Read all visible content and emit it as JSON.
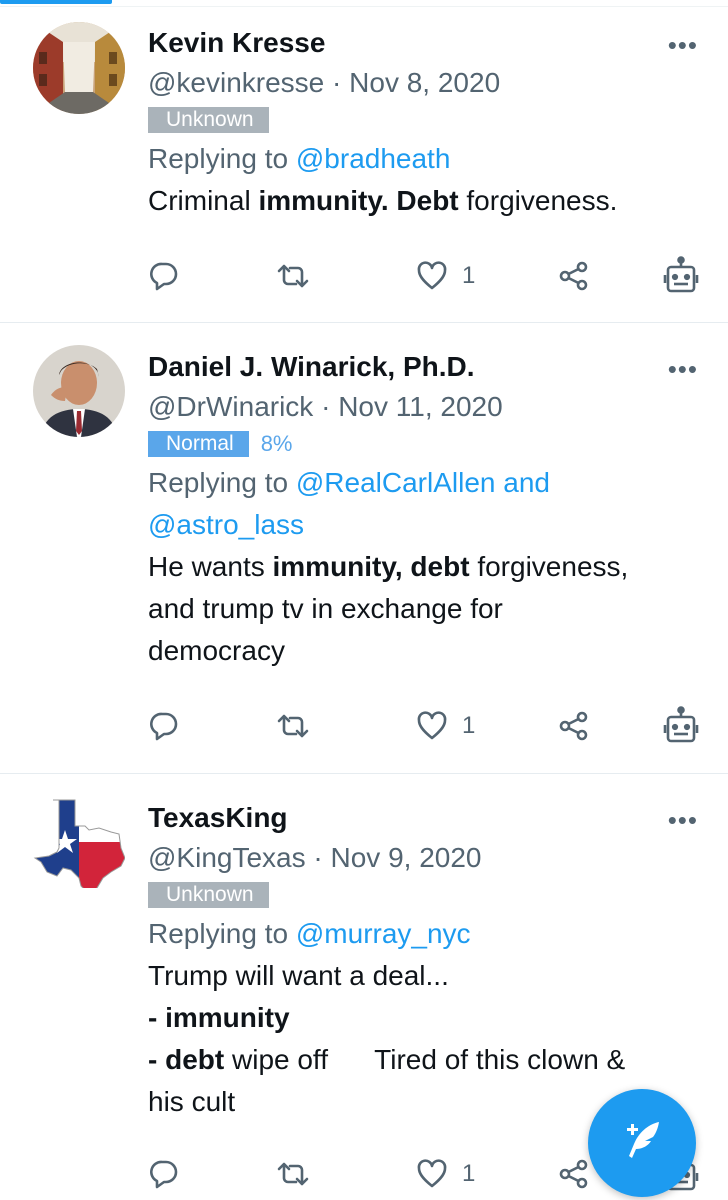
{
  "tweets": [
    {
      "name": "Kevin Kresse",
      "handle": "@kevinkresse",
      "separator": " · ",
      "date": "Nov 8, 2020",
      "badge": "Unknown",
      "score": "",
      "reply_prefix": "Replying to ",
      "reply_to": "@bradheath",
      "reply_to_2": "",
      "text_lines": [
        [
          {
            "t": "Criminal ",
            "b": false
          },
          {
            "t": "immunity. Debt",
            "b": true
          },
          {
            "t": " forgiveness.",
            "b": false
          }
        ]
      ],
      "likes": "1",
      "avatar_icon": "street-photo-avatar"
    },
    {
      "name": "Daniel J. Winarick, Ph.D.",
      "handle": "@DrWinarick",
      "separator": " · ",
      "date": "Nov 11, 2020",
      "badge": "Normal",
      "score": "8%",
      "reply_prefix": "Replying to ",
      "reply_to": "@RealCarlAllen and",
      "reply_to_2": "@astro_lass",
      "text_lines": [
        [
          {
            "t": "He wants ",
            "b": false
          },
          {
            "t": "immunity, debt",
            "b": true
          },
          {
            "t": " forgiveness,",
            "b": false
          }
        ],
        [
          {
            "t": "and trump tv in exchange for",
            "b": false
          }
        ],
        [
          {
            "t": "democracy",
            "b": false
          }
        ]
      ],
      "likes": "1",
      "avatar_icon": "portrait-avatar"
    },
    {
      "name": "TexasKing",
      "handle": "@KingTexas",
      "separator": " · ",
      "date": "Nov 9, 2020",
      "badge": "Unknown",
      "score": "",
      "reply_prefix": "Replying to ",
      "reply_to": "@murray_nyc",
      "reply_to_2": "",
      "text_lines": [
        [
          {
            "t": "Trump will want a deal...",
            "b": false
          }
        ],
        [
          {
            "t": "- immunity",
            "b": true
          }
        ],
        [
          {
            "t": "- debt",
            "b": true
          },
          {
            "t": " wipe off      Tired of this clown &",
            "b": false
          }
        ],
        [
          {
            "t": "his cult",
            "b": false
          }
        ]
      ],
      "likes": "1",
      "avatar_icon": "texas-flag-avatar"
    }
  ],
  "icons": {
    "reply": "reply-icon",
    "retweet": "retweet-icon",
    "like": "heart-icon",
    "share": "share-icon",
    "bot": "bot-icon",
    "more": "more-icon",
    "compose": "compose-tweet-icon"
  },
  "more_glyph": "•••",
  "colors": {
    "accent": "#1d9bf0",
    "unknown_badge": "#aab3ba",
    "normal_badge": "#5aa6ea",
    "secondary_text": "#536471"
  }
}
